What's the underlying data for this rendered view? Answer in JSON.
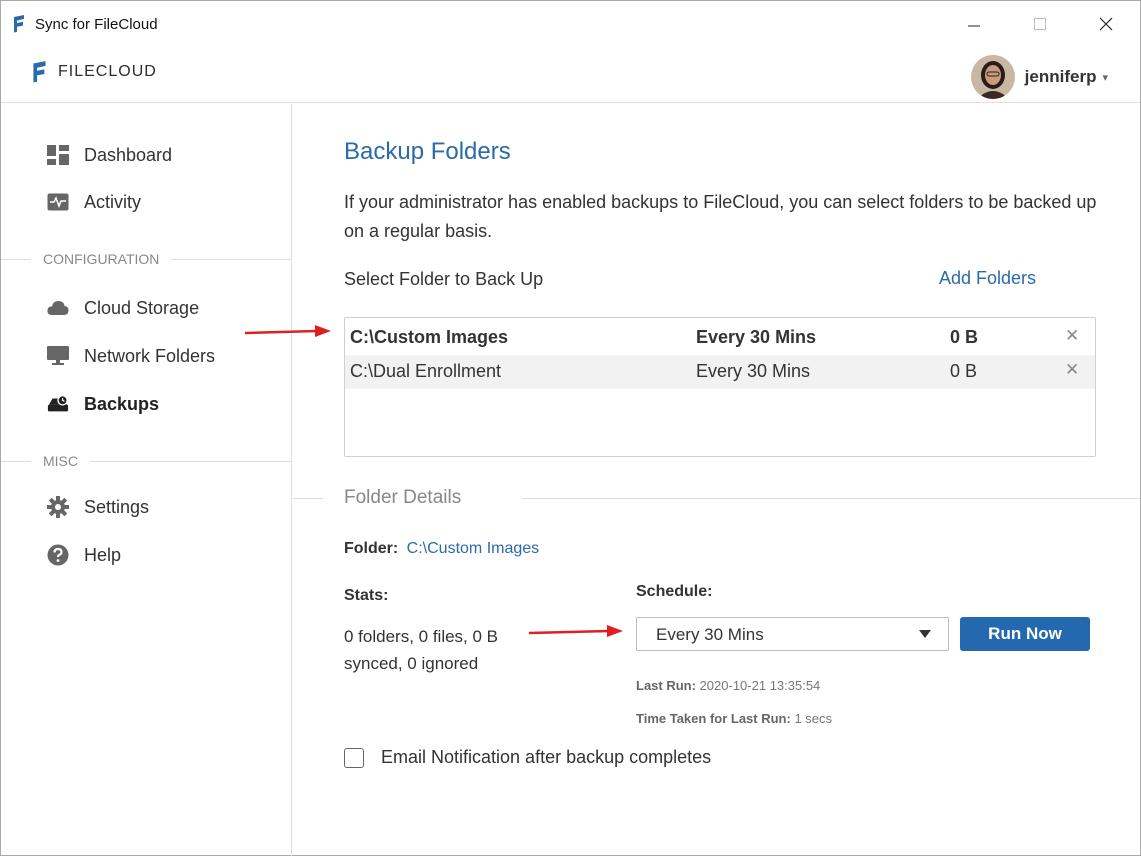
{
  "window": {
    "title": "Sync for FileCloud"
  },
  "header": {
    "logo_text": "FILECLOUD",
    "username": "jenniferp",
    "caret": "▾"
  },
  "sidebar": {
    "items": [
      {
        "label": "Dashboard",
        "icon": "dashboard-icon"
      },
      {
        "label": "Activity",
        "icon": "activity-icon"
      }
    ],
    "sections": [
      {
        "label": "CONFIGURATION",
        "items": [
          {
            "label": "Cloud Storage",
            "icon": "cloud-icon"
          },
          {
            "label": "Network Folders",
            "icon": "monitor-icon"
          },
          {
            "label": "Backups",
            "icon": "backup-drive-icon",
            "active": true
          }
        ]
      },
      {
        "label": "MISC",
        "items": [
          {
            "label": "Settings",
            "icon": "gear-icon"
          },
          {
            "label": "Help",
            "icon": "help-icon"
          }
        ]
      }
    ]
  },
  "main": {
    "title": "Backup Folders",
    "intro": "If your administrator has enabled backups to FileCloud, you can select folders to be backed up on a regular basis.",
    "select_label": "Select Folder to Back Up",
    "add_folders": "Add Folders",
    "folders": [
      {
        "path": "C:\\Custom Images",
        "schedule": "Every 30 Mins",
        "size": "0 B",
        "remove": "✕"
      },
      {
        "path": "C:\\Dual Enrollment",
        "schedule": "Every 30 Mins",
        "size": "0 B",
        "remove": "✕"
      }
    ],
    "details": {
      "heading": "Folder Details",
      "folder_label": "Folder:",
      "folder_value": "C:\\Custom Images",
      "stats_label": "Stats:",
      "stats_text": "0 folders, 0 files, 0 B synced, 0 ignored",
      "schedule_label": "Schedule:",
      "schedule_value": "Every 30 Mins",
      "run_now": "Run Now",
      "last_run_label": "Last Run:",
      "last_run_value": "2020-10-21 13:35:54",
      "time_taken_label": "Time Taken for Last Run:",
      "time_taken_value": "1 secs",
      "email_label": "Email Notification after backup completes",
      "email_checked": false
    }
  },
  "colors": {
    "accent": "#2c6aa8",
    "button": "#2468b0",
    "annotation_arrow": "#e02020"
  }
}
